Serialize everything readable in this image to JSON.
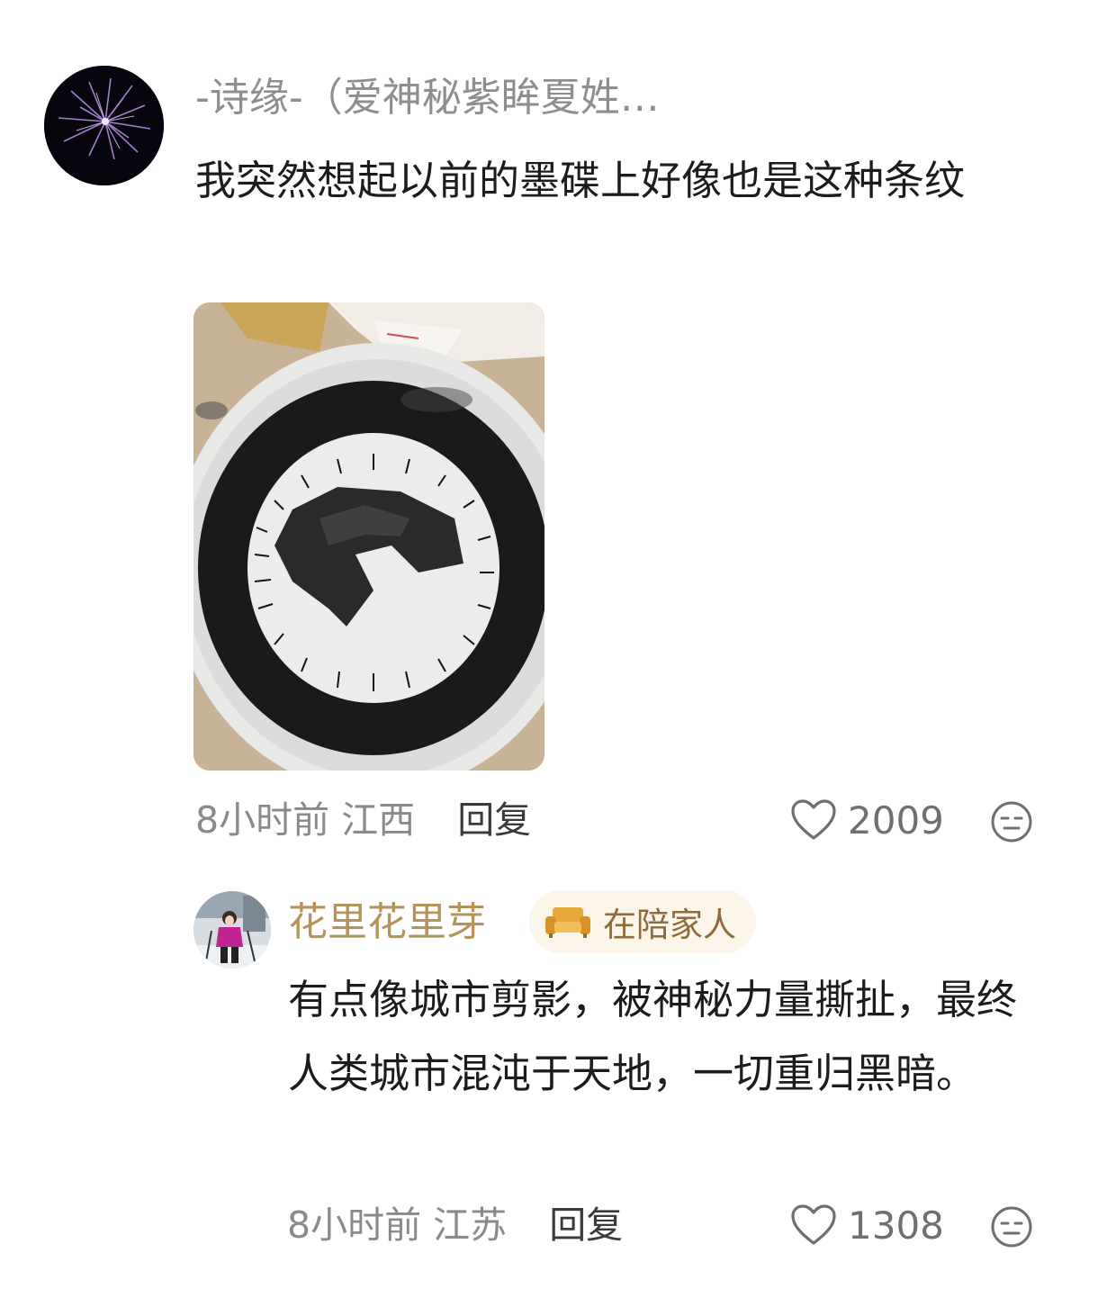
{
  "comment": {
    "username": "-诗缘-（爱神秘紫眸夏姓…",
    "content": "我突然想起以前的墨碟上好像也是这种条纹",
    "time": "8小时前",
    "location": "江西",
    "reply_label": "回复",
    "like_count": "2009",
    "icons": {
      "avatar": "fireworks-avatar",
      "like": "heart-icon",
      "reaction": "neutral-face-icon"
    }
  },
  "reply": {
    "username": "花里花里芽",
    "badge_label": "在陪家人",
    "badge_icon": "sofa-icon",
    "content": "有点像城市剪影，被神秘力量撕扯，最终人类城市混沌于天地，一切重归黑暗。",
    "time": "8小时前",
    "location": "江苏",
    "reply_label": "回复",
    "like_count": "1308",
    "icons": {
      "avatar": "skier-avatar",
      "like": "heart-icon",
      "reaction": "neutral-face-icon"
    }
  },
  "colors": {
    "username_gray": "#8e8e8e",
    "reply_username_gold": "#b4945a",
    "badge_bg": "#fbf5ea",
    "badge_text": "#8e6b39",
    "meta_gray": "#8a8a8a"
  }
}
